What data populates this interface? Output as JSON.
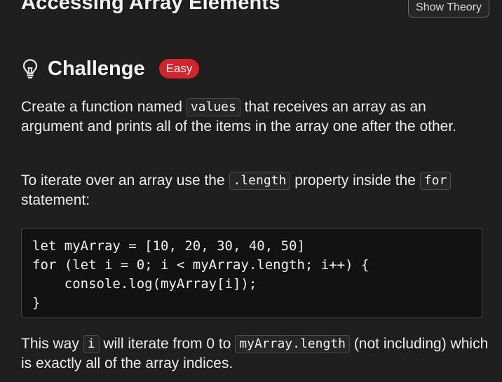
{
  "header": {
    "title": "Accessing Array Elements",
    "theory_button": "Show Theory"
  },
  "challenge": {
    "icon": "lightbulb-icon",
    "title": "Challenge",
    "difficulty": "Easy",
    "difficulty_color": "#d3232b"
  },
  "paragraph1": {
    "t1": "Create a function named ",
    "code1": "values",
    "t2": " that receives an array as an argument and prints all of the items in the array one after the other."
  },
  "paragraph2": {
    "t1": "To iterate over an array use the ",
    "code1": ".length",
    "t2": " property inside the ",
    "code2": "for",
    "t3": " statement:"
  },
  "code_example": {
    "lines": [
      "let myArray = [10, 20, 30, 40, 50]",
      "for (let i = 0; i < myArray.length; i++) {",
      "    console.log(myArray[i]);",
      "}"
    ]
  },
  "paragraph3": {
    "t1": "This way ",
    "code1": "i",
    "t2": " will iterate from 0 to ",
    "code2": "myArray.length",
    "t3": " (not including) which is exactly all of the array indices."
  }
}
